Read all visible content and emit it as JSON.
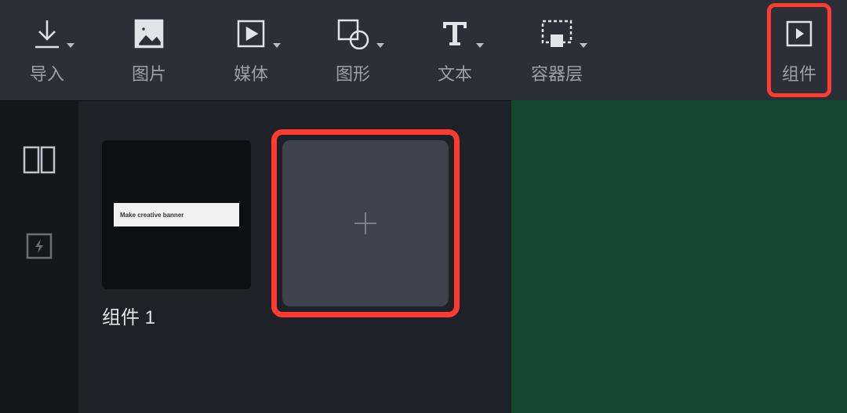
{
  "toolbar": {
    "import_label": "导入",
    "image_label": "图片",
    "media_label": "媒体",
    "shape_label": "图形",
    "text_label": "文本",
    "container_label": "容器层",
    "component_label": "组件"
  },
  "panel": {
    "component1_label": "组件 1",
    "banner_text": "Make creative banner"
  }
}
